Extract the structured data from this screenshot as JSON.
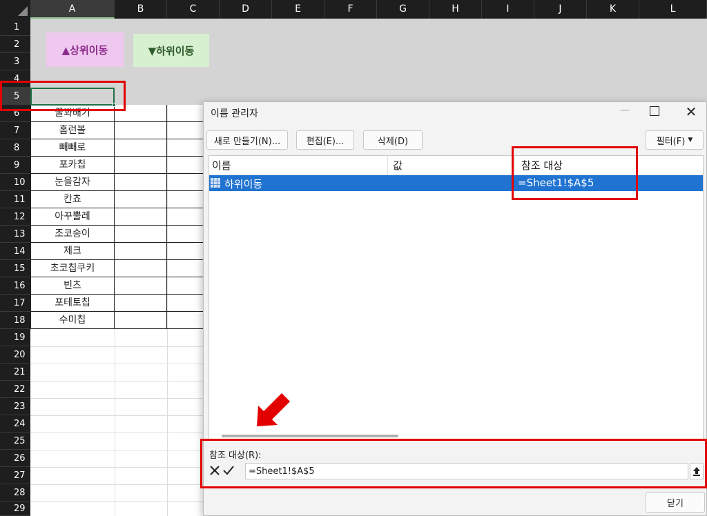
{
  "sheet": {
    "columns": [
      "A",
      "B",
      "C",
      "D",
      "E",
      "F",
      "G",
      "H",
      "I",
      "J",
      "K",
      "L"
    ],
    "rows": [
      "1",
      "2",
      "3",
      "4",
      "5",
      "6",
      "7",
      "8",
      "9",
      "10",
      "11",
      "12",
      "13",
      "14",
      "15",
      "16",
      "17",
      "18",
      "19",
      "20",
      "21",
      "22",
      "23",
      "24",
      "25",
      "26",
      "27",
      "28",
      "29"
    ],
    "selected_column": "A",
    "selected_row": "5",
    "buttons": {
      "up": "▲상위이동",
      "down": "▼하위이동"
    },
    "column_a_values": [
      "꿀꽈배기",
      "홈런볼",
      "빼빼로",
      "포카칩",
      "눈을감자",
      "칸쵸",
      "아꾸뿔레",
      "조코송이",
      "제크",
      "초코칩쿠키",
      "빈츠",
      "포테토칩",
      "수미칩"
    ]
  },
  "dialog": {
    "title": "이름 관리자",
    "buttons": {
      "new": "새로 만들기(N)...",
      "edit": "편집(E)...",
      "delete": "삭제(D)",
      "filter": "필터(F)"
    },
    "list_headers": {
      "name": "이름",
      "value": "값",
      "refers_to": "참조 대상"
    },
    "rows": [
      {
        "name": "하위이동",
        "value": "",
        "refers_to": "=Sheet1!$A$5"
      }
    ],
    "refers_to_label": "참조 대상(R):",
    "refers_to_input": "=Sheet1!$A$5",
    "close": "닫기"
  },
  "colors": {
    "accent_highlight": "#e30000",
    "selection_blue": "#2073d1",
    "excel_green": "#1e7145"
  }
}
